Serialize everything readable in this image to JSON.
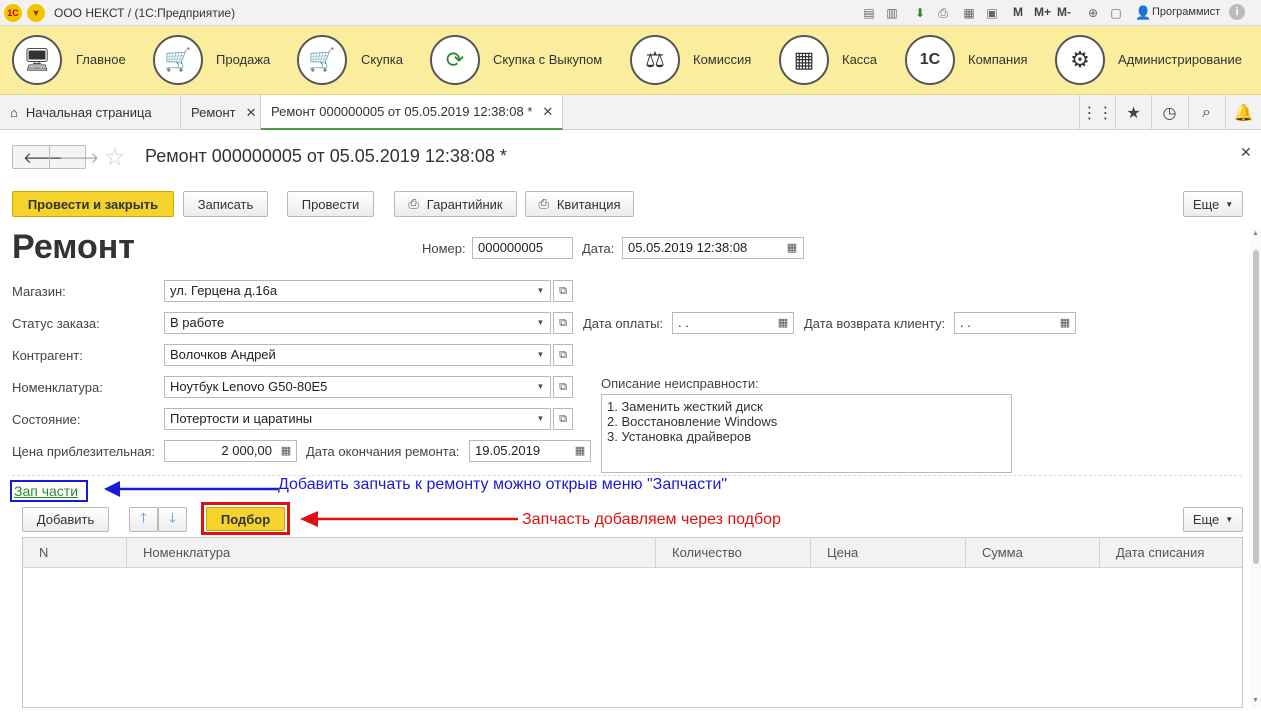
{
  "titlebar": {
    "app_title": "ООО НЕКСТ /  (1С:Предприятие)",
    "user": "Программист",
    "m1": "M",
    "m2": "M+",
    "m3": "M-"
  },
  "sections": [
    {
      "label": "Главное",
      "icon": "computer-icon"
    },
    {
      "label": "Продажа",
      "icon": "cart-up-icon"
    },
    {
      "label": "Скупка",
      "icon": "cart-down-icon"
    },
    {
      "label": "Скупка с Выкупом",
      "icon": "refresh-arrows-icon"
    },
    {
      "label": "Комиссия",
      "icon": "scales-icon"
    },
    {
      "label": "Касса",
      "icon": "cash-register-icon"
    },
    {
      "label": "Компания",
      "icon": "1c-company-icon"
    },
    {
      "label": "Администрирование",
      "icon": "gears-icon"
    }
  ],
  "tabs": [
    {
      "label": "Начальная страница"
    },
    {
      "label": "Ремонт"
    },
    {
      "label": "Ремонт 000000005 от 05.05.2019 12:38:08 *"
    }
  ],
  "form": {
    "title": "Ремонт 000000005 от 05.05.2019 12:38:08 *",
    "heading": "Ремонт"
  },
  "toolbar": {
    "post_close": "Провести и закрыть",
    "save": "Записать",
    "post": "Провести",
    "warranty": "Гарантийник",
    "receipt": "Квитанция",
    "more": "Еще"
  },
  "fields": {
    "number_label": "Номер:",
    "number": "000000005",
    "date_label": "Дата:",
    "date": "05.05.2019 12:38:08",
    "shop_label": "Магазин:",
    "shop": "ул. Герцена д.16а",
    "status_label": "Статус заказа:",
    "status": "В работе",
    "payment_date_label": "Дата оплаты:",
    "payment_date": " .  .",
    "return_date_label": "Дата возврата клиенту:",
    "return_date": " .  .",
    "contractor_label": "Контрагент:",
    "contractor": "Волочков Андрей",
    "nomenclature_label": "Номенклатура:",
    "nomenclature": "Ноутбук Lenovo G50-80E5",
    "condition_label": "Состояние:",
    "condition": "Потертости и царатины",
    "price_label": "Цена приблезительная:",
    "price": "2 000,00",
    "end_date_label": "Дата окончания ремонта:",
    "end_date": "19.05.2019",
    "fault_label": "Описание неисправности:",
    "fault_lines": [
      "1. Заменить жесткий диск",
      "2. Восстановление Windows",
      "3. Установка драйверов"
    ]
  },
  "parts": {
    "link": "Зап части",
    "add": "Добавить",
    "pick": "Подбор",
    "more": "Еще",
    "columns": [
      "N",
      "Номенклатура",
      "Количество",
      "Цена",
      "Сумма",
      "Дата списания"
    ]
  },
  "annotations": {
    "blue": "Добавить запчать к ремонту можно открыв меню \"Запчасти\"",
    "red": "Запчасть добавляем через подбор",
    "blue_color": "#1a1ad6",
    "red_color": "#e01010"
  }
}
